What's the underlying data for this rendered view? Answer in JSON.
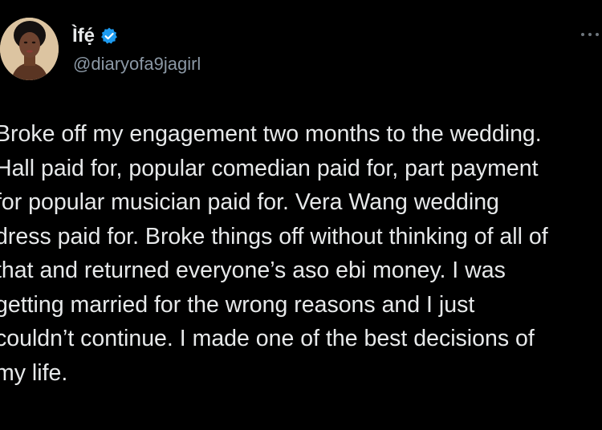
{
  "author": {
    "display_name": "Ìfẹ́",
    "handle": "@diaryofa9jagirl",
    "verified": true,
    "avatar_icon": "avatar",
    "verified_icon": "verified-badge-icon",
    "verified_color": "#1d9bf0"
  },
  "more_icon": "more-horizontal-icon",
  "tweet": {
    "lines": [
      "Broke off my engagement two months to the wedding.",
      "Hall paid for, popular comedian paid for, part payment",
      "for popular musician paid for. Vera Wang wedding",
      "dress paid for. Broke things off without thinking of all of",
      "that and returned everyone’s aso ebi money. I was",
      "getting married for the wrong reasons and I just",
      "couldn’t continue. I made one of the best decisions of",
      "my life."
    ]
  },
  "colors": {
    "background": "#000000",
    "text": "#e7e9ea",
    "secondary_text": "#8b98a5"
  }
}
